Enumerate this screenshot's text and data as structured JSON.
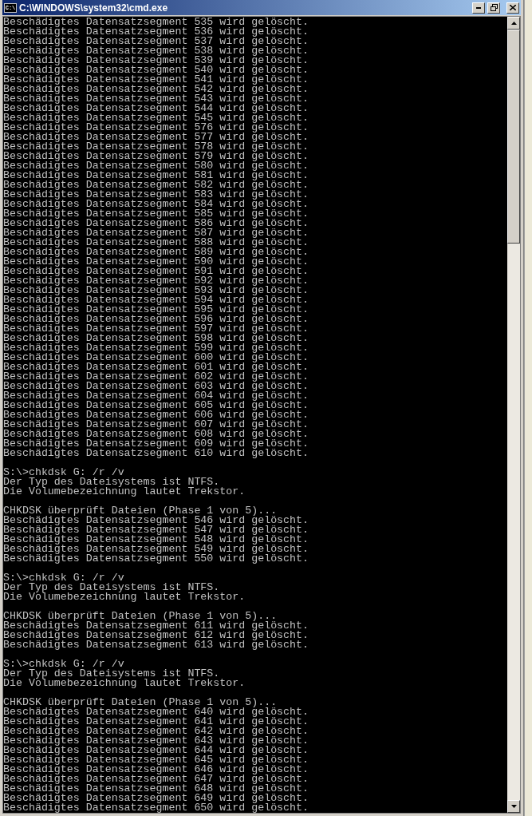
{
  "window": {
    "title": "C:\\WINDOWS\\system32\\cmd.exe",
    "icon_text": "C:\\"
  },
  "console": {
    "blocks": [
      [
        "Beschädigtes Datensatzsegment 535 wird gelöscht.",
        "Beschädigtes Datensatzsegment 536 wird gelöscht.",
        "Beschädigtes Datensatzsegment 537 wird gelöscht.",
        "Beschädigtes Datensatzsegment 538 wird gelöscht.",
        "Beschädigtes Datensatzsegment 539 wird gelöscht.",
        "Beschädigtes Datensatzsegment 540 wird gelöscht.",
        "Beschädigtes Datensatzsegment 541 wird gelöscht.",
        "Beschädigtes Datensatzsegment 542 wird gelöscht.",
        "Beschädigtes Datensatzsegment 543 wird gelöscht.",
        "Beschädigtes Datensatzsegment 544 wird gelöscht.",
        "Beschädigtes Datensatzsegment 545 wird gelöscht.",
        "Beschädigtes Datensatzsegment 576 wird gelöscht.",
        "Beschädigtes Datensatzsegment 577 wird gelöscht.",
        "Beschädigtes Datensatzsegment 578 wird gelöscht.",
        "Beschädigtes Datensatzsegment 579 wird gelöscht.",
        "Beschädigtes Datensatzsegment 580 wird gelöscht.",
        "Beschädigtes Datensatzsegment 581 wird gelöscht.",
        "Beschädigtes Datensatzsegment 582 wird gelöscht.",
        "Beschädigtes Datensatzsegment 583 wird gelöscht.",
        "Beschädigtes Datensatzsegment 584 wird gelöscht.",
        "Beschädigtes Datensatzsegment 585 wird gelöscht.",
        "Beschädigtes Datensatzsegment 586 wird gelöscht.",
        "Beschädigtes Datensatzsegment 587 wird gelöscht.",
        "Beschädigtes Datensatzsegment 588 wird gelöscht.",
        "Beschädigtes Datensatzsegment 589 wird gelöscht.",
        "Beschädigtes Datensatzsegment 590 wird gelöscht.",
        "Beschädigtes Datensatzsegment 591 wird gelöscht.",
        "Beschädigtes Datensatzsegment 592 wird gelöscht.",
        "Beschädigtes Datensatzsegment 593 wird gelöscht.",
        "Beschädigtes Datensatzsegment 594 wird gelöscht.",
        "Beschädigtes Datensatzsegment 595 wird gelöscht.",
        "Beschädigtes Datensatzsegment 596 wird gelöscht.",
        "Beschädigtes Datensatzsegment 597 wird gelöscht.",
        "Beschädigtes Datensatzsegment 598 wird gelöscht.",
        "Beschädigtes Datensatzsegment 599 wird gelöscht.",
        "Beschädigtes Datensatzsegment 600 wird gelöscht.",
        "Beschädigtes Datensatzsegment 601 wird gelöscht.",
        "Beschädigtes Datensatzsegment 602 wird gelöscht.",
        "Beschädigtes Datensatzsegment 603 wird gelöscht.",
        "Beschädigtes Datensatzsegment 604 wird gelöscht.",
        "Beschädigtes Datensatzsegment 605 wird gelöscht.",
        "Beschädigtes Datensatzsegment 606 wird gelöscht.",
        "Beschädigtes Datensatzsegment 607 wird gelöscht.",
        "Beschädigtes Datensatzsegment 608 wird gelöscht.",
        "Beschädigtes Datensatzsegment 609 wird gelöscht.",
        "Beschädigtes Datensatzsegment 610 wird gelöscht."
      ],
      [
        "S:\\>chkdsk G: /r /v",
        "Der Typ des Dateisystems ist NTFS.",
        "Die Volumebezeichnung lautet Trekstor."
      ],
      [
        "CHKDSK überprüft Dateien (Phase 1 von 5)...",
        "Beschädigtes Datensatzsegment 546 wird gelöscht.",
        "Beschädigtes Datensatzsegment 547 wird gelöscht.",
        "Beschädigtes Datensatzsegment 548 wird gelöscht.",
        "Beschädigtes Datensatzsegment 549 wird gelöscht.",
        "Beschädigtes Datensatzsegment 550 wird gelöscht."
      ],
      [
        "S:\\>chkdsk G: /r /v",
        "Der Typ des Dateisystems ist NTFS.",
        "Die Volumebezeichnung lautet Trekstor."
      ],
      [
        "CHKDSK überprüft Dateien (Phase 1 von 5)...",
        "Beschädigtes Datensatzsegment 611 wird gelöscht.",
        "Beschädigtes Datensatzsegment 612 wird gelöscht.",
        "Beschädigtes Datensatzsegment 613 wird gelöscht."
      ],
      [
        "S:\\>chkdsk G: /r /v",
        "Der Typ des Dateisystems ist NTFS.",
        "Die Volumebezeichnung lautet Trekstor."
      ],
      [
        "CHKDSK überprüft Dateien (Phase 1 von 5)...",
        "Beschädigtes Datensatzsegment 640 wird gelöscht.",
        "Beschädigtes Datensatzsegment 641 wird gelöscht.",
        "Beschädigtes Datensatzsegment 642 wird gelöscht.",
        "Beschädigtes Datensatzsegment 643 wird gelöscht.",
        "Beschädigtes Datensatzsegment 644 wird gelöscht.",
        "Beschädigtes Datensatzsegment 645 wird gelöscht.",
        "Beschädigtes Datensatzsegment 646 wird gelöscht.",
        "Beschädigtes Datensatzsegment 647 wird gelöscht.",
        "Beschädigtes Datensatzsegment 648 wird gelöscht.",
        "Beschädigtes Datensatzsegment 649 wird gelöscht.",
        "Beschädigtes Datensatzsegment 650 wird gelöscht."
      ]
    ]
  }
}
